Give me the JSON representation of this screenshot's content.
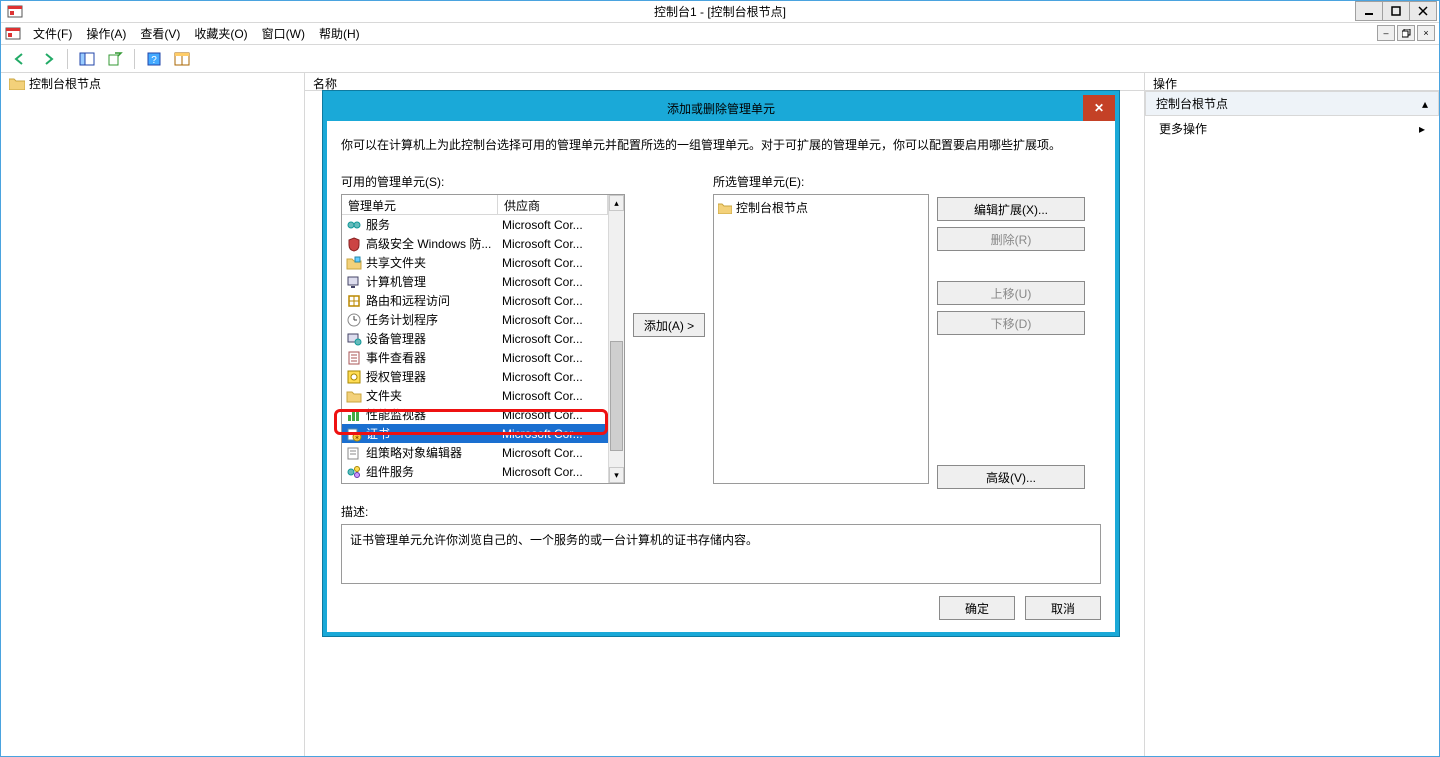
{
  "window": {
    "title": "控制台1 - [控制台根节点]"
  },
  "menu": {
    "file": "文件(F)",
    "action": "操作(A)",
    "view": "查看(V)",
    "fav": "收藏夹(O)",
    "window": "窗口(W)",
    "help": "帮助(H)"
  },
  "tree": {
    "root": "控制台根节点"
  },
  "panes": {
    "name_col": "名称",
    "actions": "操作",
    "actions_section": "控制台根节点",
    "more": "更多操作"
  },
  "dialog": {
    "title": "添加或删除管理单元",
    "intro": "你可以在计算机上为此控制台选择可用的管理单元并配置所选的一组管理单元。对于可扩展的管理单元，你可以配置要启用哪些扩展项。",
    "available_label": "可用的管理单元(S):",
    "selected_label": "所选管理单元(E):",
    "headers": {
      "snapin": "管理单元",
      "vendor": "供应商"
    },
    "selected_root": "控制台根节点",
    "add_btn": "添加(A) >",
    "buttons": {
      "edit_ext": "编辑扩展(X)...",
      "delete": "删除(R)",
      "up": "上移(U)",
      "down": "下移(D)",
      "advanced": "高级(V)..."
    },
    "desc_label": "描述:",
    "desc_text": "证书管理单元允许你浏览自己的、一个服务的或一台计算机的证书存储内容。",
    "ok": "确定",
    "cancel": "取消",
    "snapins": [
      {
        "name": "服务",
        "vendor": "Microsoft Cor..."
      },
      {
        "name": "高级安全 Windows 防...",
        "vendor": "Microsoft Cor..."
      },
      {
        "name": "共享文件夹",
        "vendor": "Microsoft Cor..."
      },
      {
        "name": "计算机管理",
        "vendor": "Microsoft Cor..."
      },
      {
        "name": "路由和远程访问",
        "vendor": "Microsoft Cor..."
      },
      {
        "name": "任务计划程序",
        "vendor": "Microsoft Cor..."
      },
      {
        "name": "设备管理器",
        "vendor": "Microsoft Cor..."
      },
      {
        "name": "事件查看器",
        "vendor": "Microsoft Cor..."
      },
      {
        "name": "授权管理器",
        "vendor": "Microsoft Cor..."
      },
      {
        "name": "文件夹",
        "vendor": "Microsoft Cor..."
      },
      {
        "name": "性能监视器",
        "vendor": "Microsoft Cor..."
      },
      {
        "name": "证书",
        "vendor": "Microsoft Cor...",
        "selected": true
      },
      {
        "name": "组策略对象编辑器",
        "vendor": "Microsoft Cor..."
      },
      {
        "name": "组件服务",
        "vendor": "Microsoft Cor..."
      }
    ]
  }
}
